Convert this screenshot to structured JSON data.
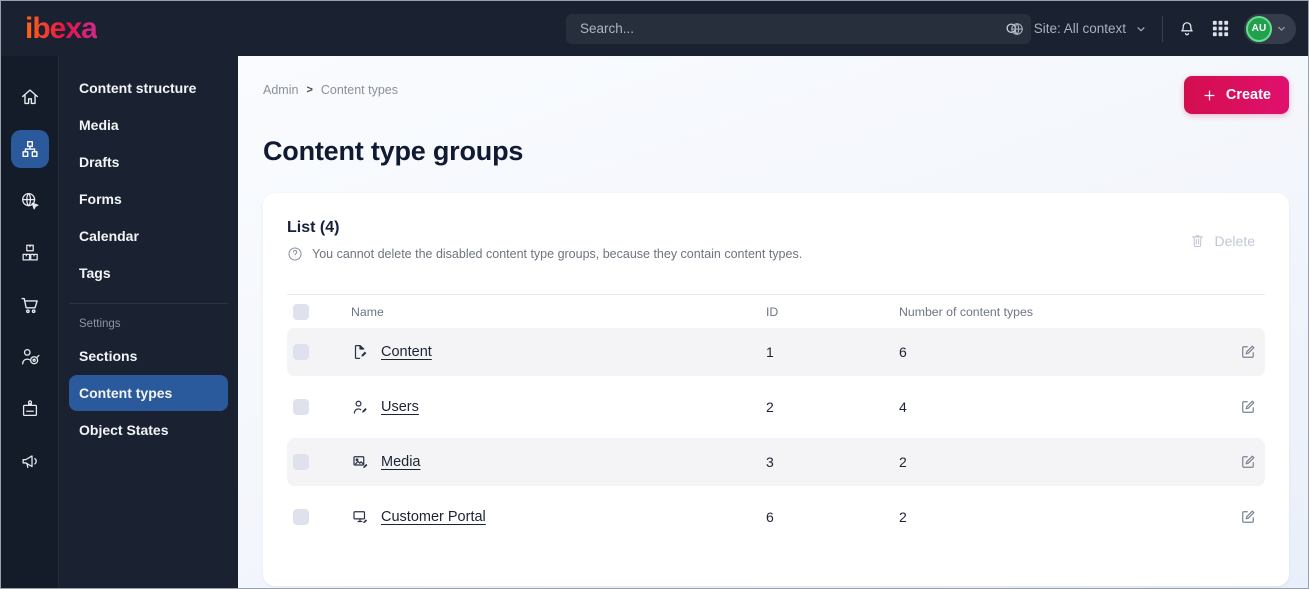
{
  "topbar": {
    "logo_text": "ibexa",
    "search": {
      "placeholder": "Search..."
    },
    "site_context_label": "Site: All context",
    "avatar_initials": "AU"
  },
  "icon_rail": [
    "home-icon",
    "sitemap-icon",
    "globe-cursor-icon",
    "boxes-icon",
    "cart-icon",
    "person-target-icon",
    "badge-icon",
    "megaphone-icon"
  ],
  "sidebar": {
    "items": [
      "Content structure",
      "Media",
      "Drafts",
      "Forms",
      "Calendar",
      "Tags"
    ],
    "settings_label": "Settings",
    "settings_items": [
      "Sections",
      "Content types",
      "Object States"
    ]
  },
  "breadcrumb": {
    "root": "Admin",
    "separator": ">",
    "current": "Content types"
  },
  "page": {
    "title": "Content type groups",
    "create_label": "Create"
  },
  "panel": {
    "title": "List (4)",
    "help_text": "You cannot delete the disabled content type groups, because they contain content types.",
    "delete_label": "Delete",
    "table": {
      "columns": [
        "Name",
        "ID",
        "Number of content types"
      ],
      "rows": [
        {
          "name": "Content",
          "id": "1",
          "count": "6"
        },
        {
          "name": "Users",
          "id": "2",
          "count": "4"
        },
        {
          "name": "Media",
          "id": "3",
          "count": "2"
        },
        {
          "name": "Customer Portal",
          "id": "6",
          "count": "2"
        }
      ]
    }
  },
  "colors": {
    "topbar_bg": "#1a2130",
    "sidebar_bg": "#1a2231",
    "accent_blue": "#2a5a9c",
    "create_gradient_start": "#d40e4e",
    "create_gradient_end": "#e0106e",
    "avatar_green": "#23a04e",
    "row_alt_bg": "#f4f4f6"
  }
}
